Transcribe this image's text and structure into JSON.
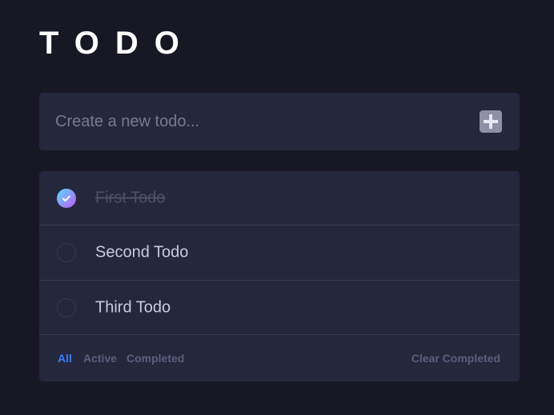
{
  "header": {
    "title": "TODO"
  },
  "new_todo": {
    "placeholder": "Create a new todo...",
    "value": "",
    "add_icon": "plus-icon"
  },
  "todos": [
    {
      "text": "First Todo",
      "completed": true
    },
    {
      "text": "Second Todo",
      "completed": false
    },
    {
      "text": "Third Todo",
      "completed": false
    }
  ],
  "footer": {
    "filters": [
      {
        "label": "All",
        "active": true
      },
      {
        "label": "Active",
        "active": false
      },
      {
        "label": "Completed",
        "active": false
      }
    ],
    "clear_label": "Clear Completed"
  },
  "colors": {
    "background": "#181824",
    "card": "#25273d",
    "accent": "#3a7cfd",
    "check_gradient_start": "#57ddff",
    "check_gradient_end": "#c058f3"
  }
}
